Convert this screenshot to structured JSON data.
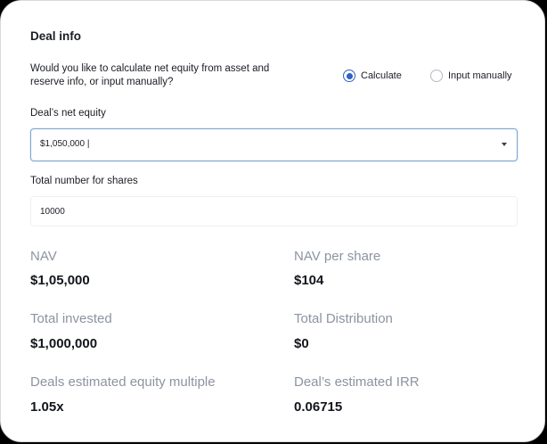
{
  "deal_info": {
    "title": "Deal info",
    "question": "Would you like to calculate net equity from asset and reserve info, or input manually?",
    "options": [
      {
        "label": "Calculate",
        "selected": true
      },
      {
        "label": "Input manually",
        "selected": false
      }
    ],
    "net_equity": {
      "label": "Deal’s net equity",
      "value": "$1,050,000 |"
    },
    "shares": {
      "label": "Total number for shares",
      "value": "10000"
    }
  },
  "stats": {
    "nav": {
      "label": "NAV",
      "value": "$1,05,000"
    },
    "nav_per_share": {
      "label": "NAV per share",
      "value": "$104"
    },
    "total_invested": {
      "label": "Total invested",
      "value": "$1,000,000"
    },
    "total_distribution": {
      "label": "Total Distribution",
      "value": "$0"
    },
    "equity_multiple": {
      "label": "Deals estimated equity multiple",
      "value": "1.05x"
    },
    "irr": {
      "label": "Deal’s estimated IRR",
      "value": "0.06715"
    }
  },
  "colors": {
    "accent": "#2f62c2",
    "muted_label": "#8c94a1",
    "focus_border": "#7fa6d2"
  },
  "icons": {
    "dropdown": "chevron-down-icon"
  }
}
